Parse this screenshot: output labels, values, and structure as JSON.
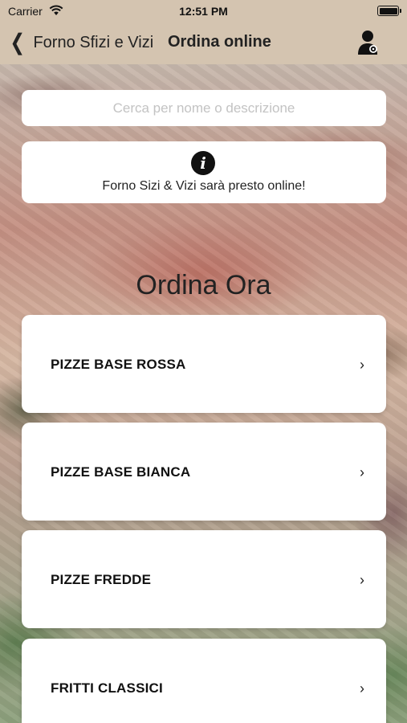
{
  "status_bar": {
    "carrier": "Carrier",
    "time": "12:51 PM"
  },
  "nav": {
    "back_label": "Forno Sfizi e Vizi",
    "title": "Ordina online",
    "user_icon": "user-settings-icon"
  },
  "search": {
    "placeholder": "Cerca per nome o descrizione",
    "value": ""
  },
  "info": {
    "icon": "info-icon",
    "text": "Forno Sizi & Vizi sarà presto online!"
  },
  "section_title": "Ordina Ora",
  "categories": [
    {
      "label": "PIZZE BASE ROSSA",
      "chevron": "›"
    },
    {
      "label": "PIZZE BASE BIANCA",
      "chevron": "›"
    },
    {
      "label": "PIZZE FREDDE",
      "chevron": "›"
    },
    {
      "label": "FRITTI CLASSICI",
      "chevron": "›"
    }
  ],
  "colors": {
    "nav_background": "#d4c4b0",
    "card_background": "#ffffff",
    "text": "#111111"
  }
}
